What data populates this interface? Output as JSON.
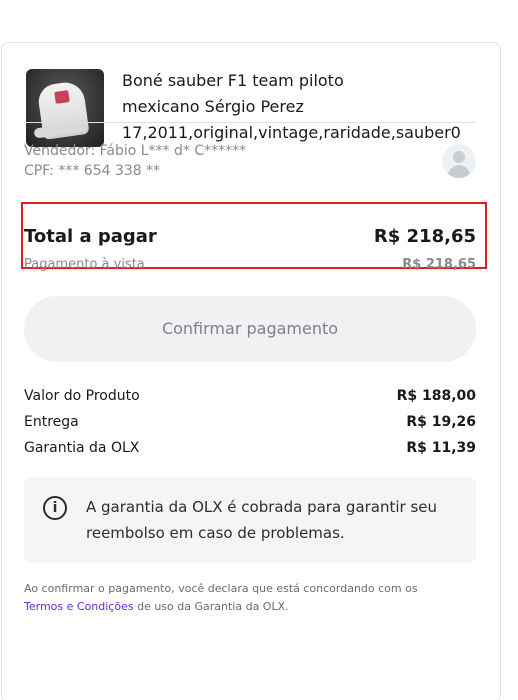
{
  "product": {
    "title_line1": "Boné sauber F1 team piloto",
    "title_line2": "mexicano Sérgio Perez",
    "title_line3": "17,2011,original,vintage,raridade,sauber0"
  },
  "seller": {
    "name": "Vendedor: Fábio L*** d* C******",
    "cpf": "CPF: *** 654 338 **"
  },
  "total": {
    "label": "Total a pagar",
    "value": "R$ 218,65",
    "avista_label": "Pagamento à vista",
    "avista_value": "R$ 218,65"
  },
  "confirm_button": {
    "label": "Confirmar pagamento"
  },
  "breakdown": [
    {
      "label": "Valor do Produto",
      "value": "R$ 188,00"
    },
    {
      "label": "Entrega",
      "value": "R$ 19,26"
    },
    {
      "label": "Garantia da OLX",
      "value": "R$ 11,39"
    }
  ],
  "info": {
    "icon": "info-icon",
    "text_line1": "A garantia da OLX é cobrada para garantir seu",
    "text_line2": "reembolso em caso de problemas."
  },
  "disclaimer": {
    "text_before": "Ao confirmar o pagamento, você declara que está concordando com os",
    "link_text": "Termos e Condições",
    "text_after": " de uso da Garantia da OLX."
  },
  "colors": {
    "highlight": "#e02020",
    "link": "#6a2ec9",
    "button_bg": "#f0f1f3"
  }
}
